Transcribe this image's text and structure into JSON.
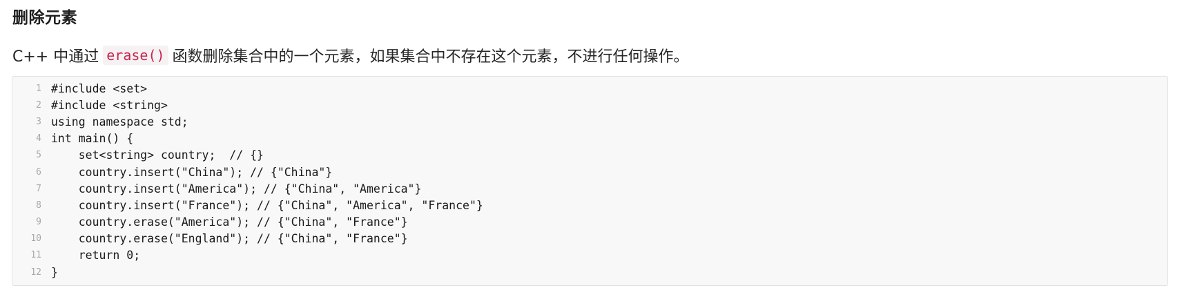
{
  "section": {
    "title": "删除元素"
  },
  "paragraph": {
    "before": "C++ 中通过",
    "code": "erase()",
    "after": "函数删除集合中的一个元素，如果集合中不存在这个元素，不进行任何操作。"
  },
  "code": {
    "lines": [
      {
        "no": "1",
        "text": "#include <set>"
      },
      {
        "no": "2",
        "text": "#include <string>"
      },
      {
        "no": "3",
        "text": "using namespace std;"
      },
      {
        "no": "4",
        "text": "int main() {"
      },
      {
        "no": "5",
        "text": "    set<string> country;  // {}"
      },
      {
        "no": "6",
        "text": "    country.insert(\"China\"); // {\"China\"}"
      },
      {
        "no": "7",
        "text": "    country.insert(\"America\"); // {\"China\", \"America\"}"
      },
      {
        "no": "8",
        "text": "    country.insert(\"France\"); // {\"China\", \"America\", \"France\"}"
      },
      {
        "no": "9",
        "text": "    country.erase(\"America\"); // {\"China\", \"France\"}"
      },
      {
        "no": "10",
        "text": "    country.erase(\"England\"); // {\"China\", \"France\"}"
      },
      {
        "no": "11",
        "text": "    return 0;"
      },
      {
        "no": "12",
        "text": "}"
      }
    ]
  }
}
